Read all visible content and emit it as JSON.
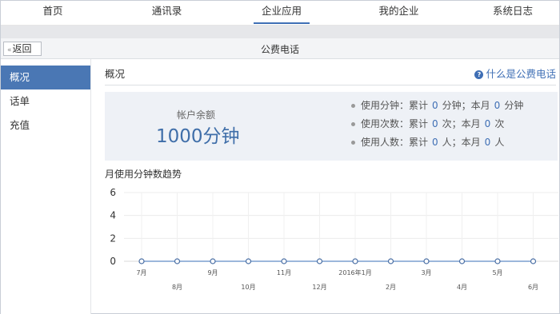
{
  "topnav": {
    "tabs": [
      {
        "label": "首页",
        "active": false
      },
      {
        "label": "通讯录",
        "active": false
      },
      {
        "label": "企业应用",
        "active": true
      },
      {
        "label": "我的企业",
        "active": false
      },
      {
        "label": "系统日志",
        "active": false
      }
    ]
  },
  "subheader": {
    "back_label": "返回",
    "title": "公费电话"
  },
  "sidebar": {
    "items": [
      {
        "label": "概况",
        "active": true
      },
      {
        "label": "话单",
        "active": false
      },
      {
        "label": "充值",
        "active": false
      }
    ]
  },
  "main": {
    "section_title": "概况",
    "help_link": "什么是公费电话",
    "balance_label": "帐户余额",
    "balance_value": "1000分钟",
    "stats": [
      {
        "prefix": "使用分钟：累计",
        "total": "0",
        "mid": "分钟；本月",
        "month": "0",
        "suffix": "分钟"
      },
      {
        "prefix": "使用次数：累计",
        "total": "0",
        "mid": "次；本月",
        "month": "0",
        "suffix": "次"
      },
      {
        "prefix": "使用人数：累计",
        "total": "0",
        "mid": "人；本月",
        "month": "0",
        "suffix": "人"
      }
    ],
    "chart_title": "月使用分钟数趋势"
  },
  "colors": {
    "accent": "#3f6fb5",
    "sidebar_active": "#4a77b4",
    "line": "#7b9fcf"
  },
  "chart_data": {
    "type": "line",
    "title": "月使用分钟数趋势",
    "categories": [
      "7月",
      "8月",
      "9月",
      "10月",
      "11月",
      "12月",
      "2016年1月",
      "2月",
      "3月",
      "4月",
      "5月",
      "6月"
    ],
    "series": [
      {
        "values": [
          0,
          0,
          0,
          0,
          0,
          0,
          0,
          0,
          0,
          0,
          0,
          0
        ]
      }
    ],
    "yticks": [
      0,
      2,
      4,
      6
    ],
    "ylim": [
      0,
      6
    ],
    "grid": true,
    "legend": "none"
  }
}
